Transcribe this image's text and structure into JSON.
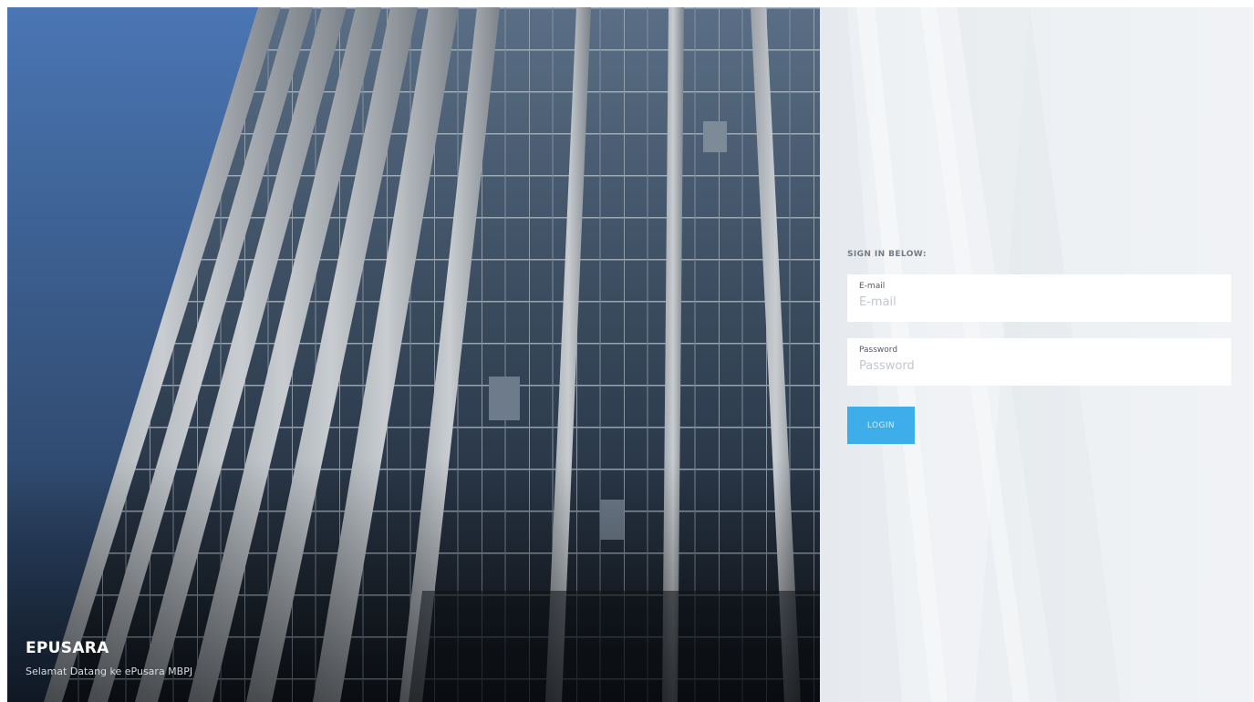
{
  "brand": {
    "name": "EPUSARA",
    "tagline": "Selamat Datang ke ePusara MBPJ"
  },
  "login_form": {
    "heading": "SIGN IN BELOW:",
    "email": {
      "label": "E-mail",
      "placeholder": "E-mail",
      "value": ""
    },
    "password": {
      "label": "Password",
      "placeholder": "Password",
      "value": ""
    },
    "login_button": "LOGIN"
  },
  "colors": {
    "accent": "#3daee9",
    "sky": "#3d6aa5",
    "panel_background": "#eef1f4"
  }
}
